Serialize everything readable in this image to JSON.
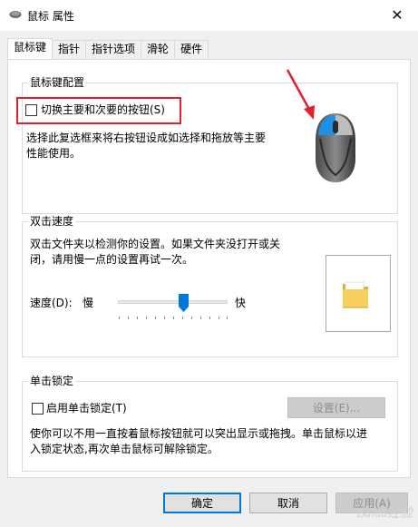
{
  "window": {
    "title": "鼠标 属性",
    "close_glyph": "✕"
  },
  "tabs": [
    {
      "label": "鼠标键",
      "active": true
    },
    {
      "label": "指针"
    },
    {
      "label": "指针选项"
    },
    {
      "label": "滑轮"
    },
    {
      "label": "硬件"
    }
  ],
  "button_config": {
    "legend": "鼠标键配置",
    "swap_label": "切换主要和次要的按钮(S)",
    "swap_checked": false,
    "description_line1": "选择此复选框来将右按钮设成如选择和拖放等主要",
    "description_line2": "性能使用。"
  },
  "double_click": {
    "legend": "双击速度",
    "description_line1": "双击文件夹以检测你的设置。如果文件夹没打开或关",
    "description_line2": "闭，请用慢一点的设置再试一次。",
    "speed_label": "速度(D):",
    "slow_label": "慢",
    "fast_label": "快",
    "speed_value": 0.6
  },
  "click_lock": {
    "legend": "单击锁定",
    "enable_label": "启用单击锁定(T)",
    "enable_checked": false,
    "settings_button": "设置(E)...",
    "description_line1": "使你可以不用一直按着鼠标按钮就可以突出显示或拖拽。单击鼠标以进",
    "description_line2": "入锁定状态,再次单击鼠标可解除锁定。"
  },
  "footer": {
    "ok": "确定",
    "cancel": "取消",
    "apply": "应用(A)"
  },
  "watermark": "Baidu经验",
  "colors": {
    "highlight": "#e0202a",
    "arrow": "#e0202a",
    "mouse_accent": "#1e90e8"
  }
}
